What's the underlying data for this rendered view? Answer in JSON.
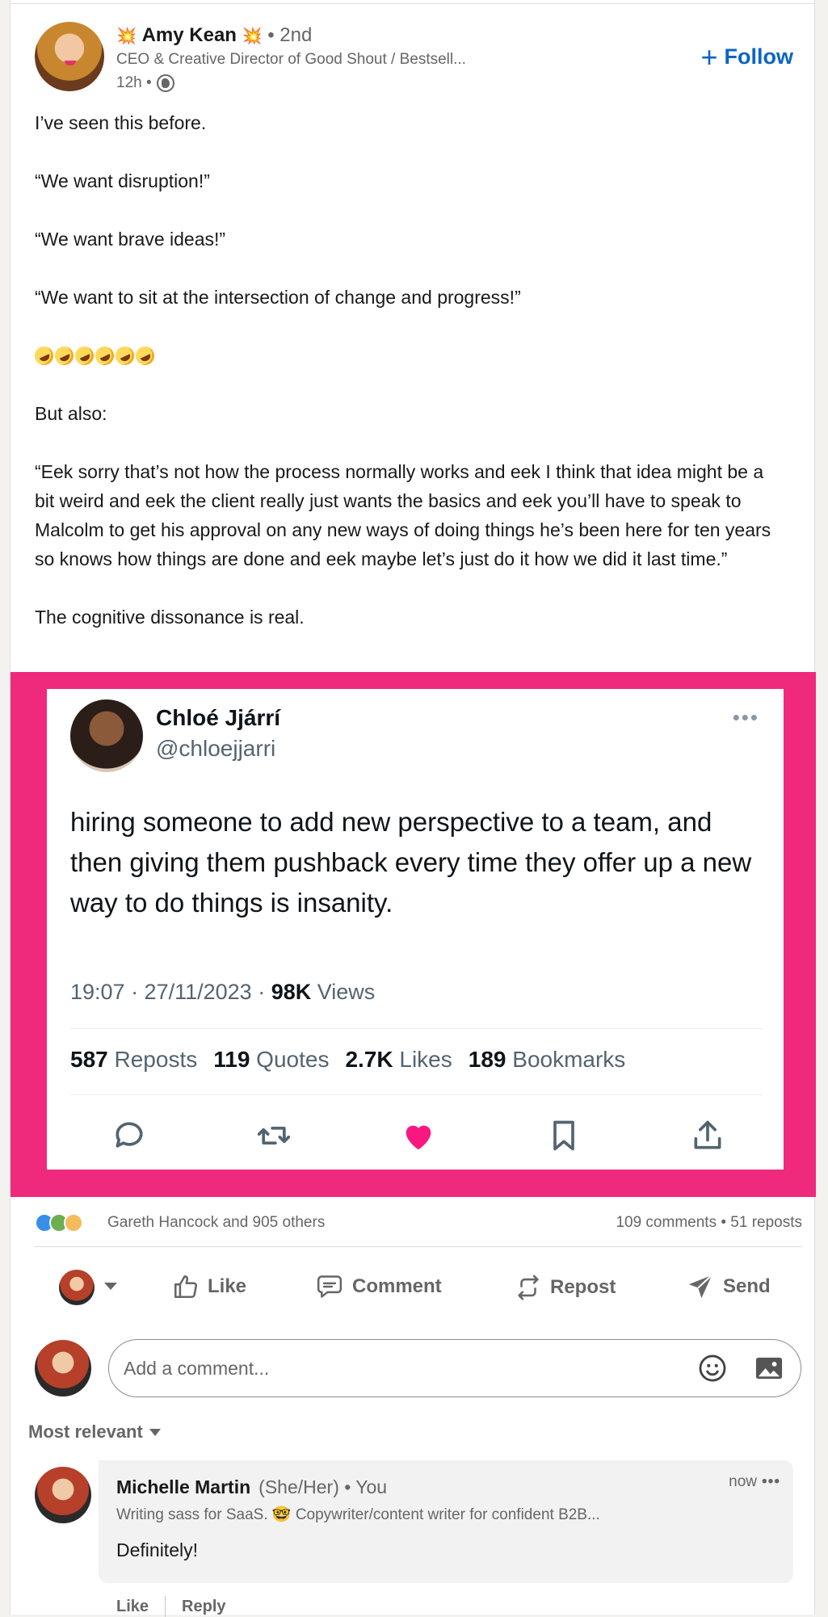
{
  "post": {
    "author": {
      "name": "Amy Kean",
      "spark_left": "💥",
      "spark_right": "💥",
      "degree": "• 2nd",
      "headline": "CEO & Creative Director of Good Shout / Bestsell...",
      "time": "12h •"
    },
    "follow_label": "Follow",
    "follow_plus": "+",
    "paragraphs": [
      "I’ve seen this before.",
      "“We want disruption!”",
      "“We want brave ideas!”",
      "“We want to sit at the intersection of change and progress!”"
    ],
    "paragraph_but": "But also:",
    "paragraph_long": "“Eek sorry that’s not how the process normally works and eek I think that idea might be a bit weird and eek the client really just wants the basics and eek you’ll have to speak to Malcolm to get his approval on any new ways of doing things he’s been here for ten years so knows how things are done and eek maybe let’s just do it how we did it last time.”",
    "paragraph_end": "The cognitive dissonance is real."
  },
  "tweet": {
    "name": "Chloé Jjárrí",
    "handle": "@chloejjarri",
    "more": "•••",
    "text": "hiring someone to add new perspective to a team, and then giving them pushback every time they offer up a new way to do things is insanity.",
    "timestamp": "19:07 · 27/11/2023 ·",
    "views_count": "98K",
    "views_label": "Views",
    "stats": {
      "reposts_count": "587",
      "reposts_label": "Reposts",
      "quotes_count": "119",
      "quotes_label": "Quotes",
      "likes_count": "2.7K",
      "likes_label": "Likes",
      "bookmarks_count": "189",
      "bookmarks_label": "Bookmarks"
    },
    "accent": "#f91880",
    "frame_color": "#ef2a7d"
  },
  "social": {
    "reactions_text": "Gareth Hancock and 905 others",
    "comments_reposts": "109 comments • 51 reposts"
  },
  "actions": {
    "like": "Like",
    "comment": "Comment",
    "repost": "Repost",
    "send": "Send"
  },
  "comment_box": {
    "placeholder": "Add a comment..."
  },
  "sort_label": "Most relevant",
  "comments": [
    {
      "name": "Michelle Martin",
      "pronouns": "(She/Her)",
      "relation": "• You",
      "headline": "Writing sass for SaaS. 🤓 Copywriter/content writer for confident B2B...",
      "time": "now",
      "dots": "•••",
      "text": "Definitely!",
      "like": "Like",
      "reply": "Reply"
    }
  ]
}
